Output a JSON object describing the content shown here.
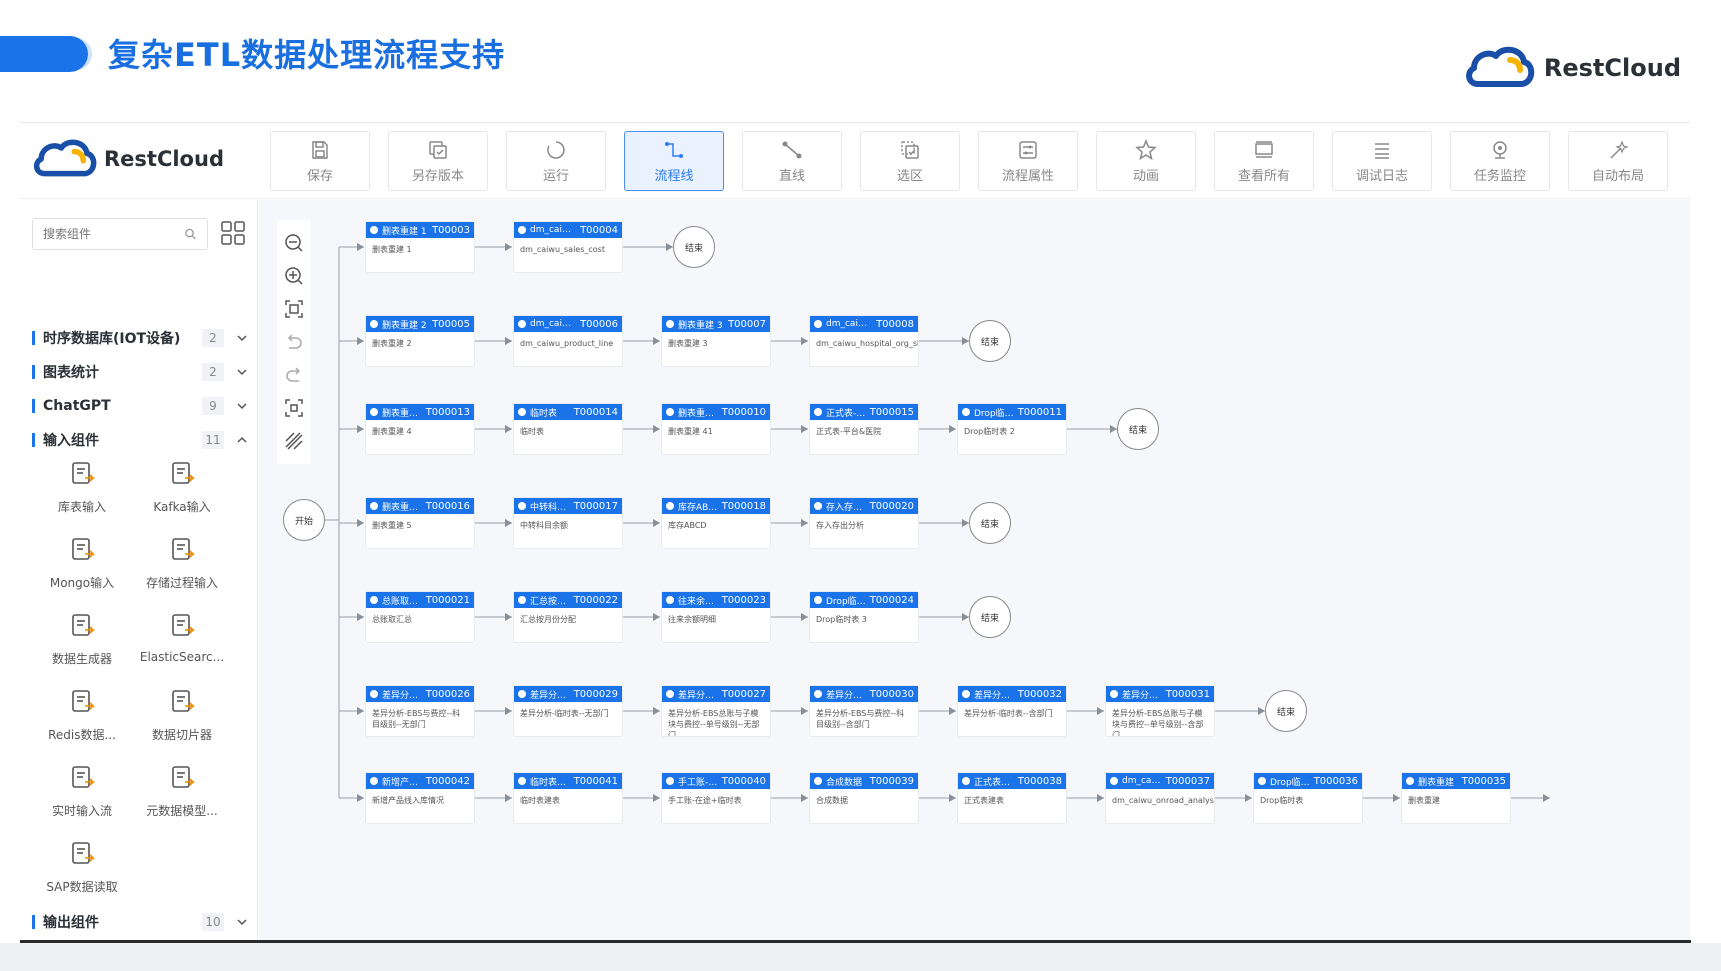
{
  "slide": {
    "title": "复杂ETL数据处理流程支持",
    "brand": "RestCloud"
  },
  "app": {
    "logo_text": "RestCloud",
    "toolbar": [
      {
        "label": "保存",
        "icon": "save-icon"
      },
      {
        "label": "另存版本",
        "icon": "copy-version-icon"
      },
      {
        "label": "运行",
        "icon": "run-icon"
      },
      {
        "label": "流程线",
        "icon": "flow-line-icon",
        "active": true
      },
      {
        "label": "直线",
        "icon": "straight-line-icon"
      },
      {
        "label": "选区",
        "icon": "select-area-icon"
      },
      {
        "label": "流程属性",
        "icon": "flow-properties-icon"
      },
      {
        "label": "动画",
        "icon": "animation-icon"
      },
      {
        "label": "查看所有",
        "icon": "view-all-icon"
      },
      {
        "label": "调试日志",
        "icon": "debug-log-icon"
      },
      {
        "label": "任务监控",
        "icon": "task-monitor-icon"
      },
      {
        "label": "自动布局",
        "icon": "auto-layout-icon"
      }
    ],
    "accent": "#1a73e8"
  },
  "sidebar": {
    "search_placeholder": "搜索组件",
    "categories": [
      {
        "label": "时序数据库(IOT设备)",
        "count": "2",
        "expanded": false
      },
      {
        "label": "图表统计",
        "count": "2",
        "expanded": false
      },
      {
        "label": "ChatGPT",
        "count": "9",
        "expanded": false
      },
      {
        "label": "输入组件",
        "count": "11",
        "expanded": true
      }
    ],
    "components": [
      {
        "label": "库表输入",
        "icon": "table-input-icon"
      },
      {
        "label": "Kafka输入",
        "icon": "kafka-input-icon"
      },
      {
        "label": "Mongo输入",
        "icon": "mongo-input-icon"
      },
      {
        "label": "存储过程输入",
        "icon": "stored-procedure-icon"
      },
      {
        "label": "数据生成器",
        "icon": "data-generator-icon"
      },
      {
        "label": "ElasticSearc...",
        "icon": "elasticsearch-icon"
      },
      {
        "label": "Redis数据...",
        "icon": "redis-icon"
      },
      {
        "label": "数据切片器",
        "icon": "data-slicer-icon"
      },
      {
        "label": "实时输入流",
        "icon": "realtime-input-icon"
      },
      {
        "label": "元数据模型...",
        "icon": "metadata-model-icon"
      },
      {
        "label": "SAP数据读取",
        "icon": "sap-read-icon"
      }
    ],
    "footer_category": {
      "label": "输出组件",
      "count": "10"
    }
  },
  "canvas": {
    "start_label": "开始",
    "end_label": "结束",
    "rows": [
      [
        {
          "name": "删表重建 1",
          "id": "T00003",
          "body": "删表重建 1"
        },
        {
          "name": "dm_caiwu_...",
          "id": "T00004",
          "body": "dm_caiwu_sales_cost"
        }
      ],
      [
        {
          "name": "删表重建 2",
          "id": "T00005",
          "body": "删表重建 2"
        },
        {
          "name": "dm_caiwu_...",
          "id": "T00006",
          "body": "dm_caiwu_product_line"
        },
        {
          "name": "删表重建 3",
          "id": "T00007",
          "body": "删表重建 3"
        },
        {
          "name": "dm_caiwu_...",
          "id": "T00008",
          "body": "dm_caiwu_hospital_org_ship"
        }
      ],
      [
        {
          "name": "删表重建 4",
          "id": "T000013",
          "body": "删表重建 4"
        },
        {
          "name": "临时表",
          "id": "T000014",
          "body": "临时表"
        },
        {
          "name": "删表重建 41",
          "id": "T000010",
          "body": "删表重建 41"
        },
        {
          "name": "正式表-平...",
          "id": "T000015",
          "body": "正式表-平台&医院"
        },
        {
          "name": "Drop临时...",
          "id": "T000011",
          "body": "Drop临时表 2"
        }
      ],
      [
        {
          "name": "删表重建 5",
          "id": "T000016",
          "body": "删表重建 5"
        },
        {
          "name": "中转科目...",
          "id": "T000017",
          "body": "中转科目余额"
        },
        {
          "name": "库存ABCD",
          "id": "T000018",
          "body": "库存ABCD"
        },
        {
          "name": "存入存出...",
          "id": "T000020",
          "body": "存入存出分析"
        }
      ],
      [
        {
          "name": "总账取汇总",
          "id": "T000021",
          "body": "总账取汇总"
        },
        {
          "name": "汇总按月...",
          "id": "T000022",
          "body": "汇总按月份分配"
        },
        {
          "name": "往来余额...",
          "id": "T000023",
          "body": "往来余额明细"
        },
        {
          "name": "Drop临时...",
          "id": "T000024",
          "body": "Drop临时表 3"
        }
      ],
      [
        {
          "name": "差异分析-...",
          "id": "T000026",
          "body": "差异分析-EBS与费控--科目级别--无部门"
        },
        {
          "name": "差异分析-...",
          "id": "T000029",
          "body": "差异分析-临时表--无部门"
        },
        {
          "name": "差异分析-...",
          "id": "T000027",
          "body": "差异分析-EBS总账与子模块与费控--单号级别--无部门"
        },
        {
          "name": "差异分析-...",
          "id": "T000030",
          "body": "差异分析-EBS与费控--科目级别--含部门"
        },
        {
          "name": "差异分析-...",
          "id": "T000032",
          "body": "差异分析-临时表--含部门"
        },
        {
          "name": "差异分析-...",
          "id": "T000031",
          "body": "差异分析-EBS总账与子模块与费控--单号级别--含部门"
        }
      ],
      [
        {
          "name": "新增产品...",
          "id": "T000042",
          "body": "新增产品线入库情况"
        },
        {
          "name": "临时表建表",
          "id": "T000041",
          "body": "临时表建表"
        },
        {
          "name": "手工账-在...",
          "id": "T000040",
          "body": "手工账-在途+临时表"
        },
        {
          "name": "合成数据",
          "id": "T000039",
          "body": "合成数据"
        },
        {
          "name": "正式表建表",
          "id": "T000038",
          "body": "正式表建表"
        },
        {
          "name": "dm_caiwu_...",
          "id": "T000037",
          "body": "dm_caiwu_onroad_analysis"
        },
        {
          "name": "Drop临时表",
          "id": "T000036",
          "body": "Drop临时表"
        },
        {
          "name": "删表重建",
          "id": "T000035",
          "body": "删表重建"
        }
      ]
    ]
  }
}
